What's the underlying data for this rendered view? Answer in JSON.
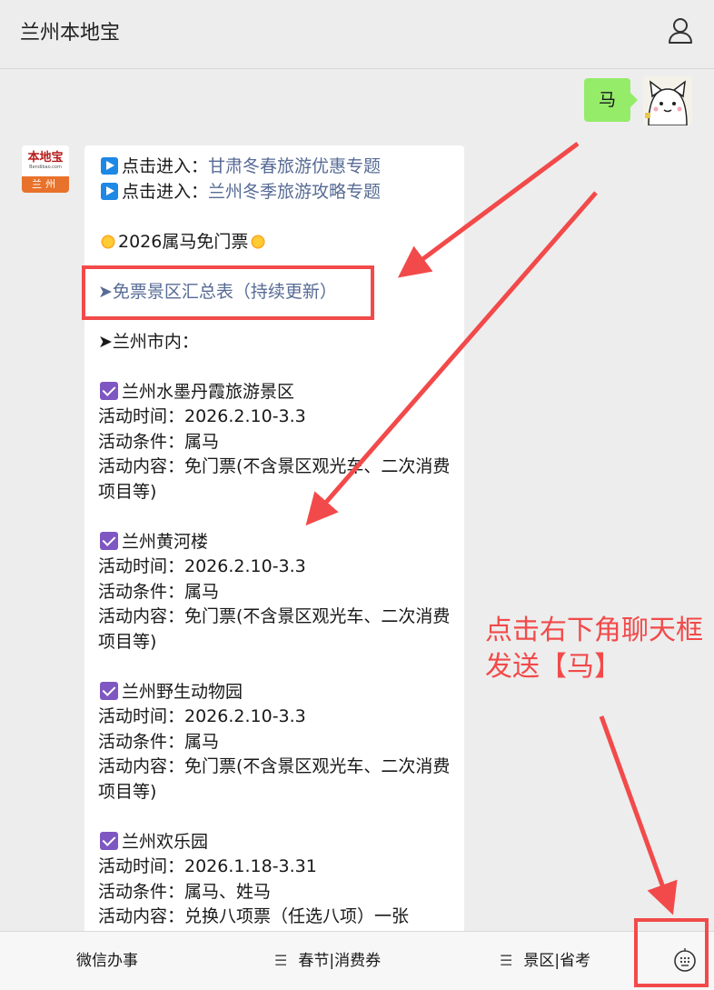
{
  "header": {
    "title": "兰州本地宝",
    "user_icon": "user-icon"
  },
  "user_message": {
    "text": "马"
  },
  "bot_avatar": {
    "brand": "本地宝",
    "domain": "Bendibao.com",
    "city": "兰州"
  },
  "message": {
    "link_rows": [
      {
        "prefix": "点击进入：",
        "link": "甘肃冬春旅游优惠专题"
      },
      {
        "prefix": "点击进入：",
        "link": "兰州冬季旅游攻略专题"
      }
    ],
    "heading": "2026属马免门票",
    "summary_link": "➤免票景区汇总表（持续更新）",
    "section": "➤兰州市内：",
    "spots": [
      {
        "name": "兰州水墨丹霞旅游景区",
        "time": "活动时间：2026.2.10-3.3",
        "condition": "活动条件：属马",
        "content": "活动内容：免门票(不含景区观光车、二次消费项目等)"
      },
      {
        "name": "兰州黄河楼",
        "time": "活动时间：2026.2.10-3.3",
        "condition": "活动条件：属马",
        "content": "活动内容：免门票(不含景区观光车、二次消费项目等)"
      },
      {
        "name": "兰州野生动物园",
        "time": "活动时间：2026.2.10-3.3",
        "condition": "活动条件：属马",
        "content": "活动内容：免门票(不含景区观光车、二次消费项目等)"
      },
      {
        "name": "兰州欢乐园",
        "time": "活动时间：2026.1.18-3.31",
        "condition": "活动条件：属马、姓马",
        "content": "活动内容：兑换八项票（任选八项）一张"
      }
    ]
  },
  "annotation": {
    "line1": "点击右下角聊天框",
    "line2": "发送【马】"
  },
  "bottom_menu": [
    {
      "label": "微信办事"
    },
    {
      "label": "春节|消费券"
    },
    {
      "label": "景区|省考"
    }
  ],
  "colors": {
    "accent_red": "#f24a4a",
    "link_blue": "#576b95",
    "bubble_green": "#95ec69"
  }
}
